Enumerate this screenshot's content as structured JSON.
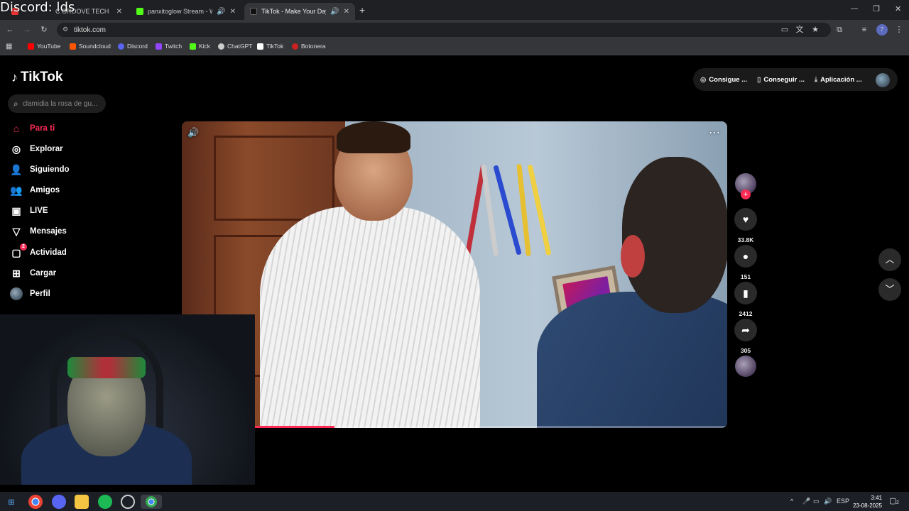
{
  "overlay": {
    "discord_text": "Discord: lds"
  },
  "tabs": [
    {
      "label": "C GROOVE TECH",
      "active": false
    },
    {
      "label": "panxitoglow Stream - Wat",
      "active": false
    },
    {
      "label": "TikTok - Make Your Day",
      "active": true
    }
  ],
  "new_tab": "+",
  "window": {
    "minimize": "—",
    "restore": "❐",
    "close": "✕"
  },
  "address": {
    "url": "tiktok.com"
  },
  "bookmarks": [
    {
      "label": "YouTube",
      "color": "#ff0000"
    },
    {
      "label": "Soundcloud",
      "color": "#ff5500"
    },
    {
      "label": "Discord",
      "color": "#5865f2"
    },
    {
      "label": "Twitch",
      "color": "#9146ff"
    },
    {
      "label": "Kick",
      "color": "#53fc18"
    },
    {
      "label": "ChatGPT",
      "color": "#cccccc"
    },
    {
      "label": "TikTok",
      "color": "#ffffff"
    },
    {
      "label": "Botonera",
      "color": "#cc2222"
    }
  ],
  "tiktok": {
    "logo": "TikTok",
    "search_placeholder": "clamidia la rosa de gu...",
    "nav": [
      {
        "label": "Para ti",
        "icon": "home-icon",
        "active": true
      },
      {
        "label": "Explorar",
        "icon": "compass-icon"
      },
      {
        "label": "Siguiendo",
        "icon": "following-icon"
      },
      {
        "label": "Amigos",
        "icon": "friends-icon"
      },
      {
        "label": "LIVE",
        "icon": "live-icon"
      },
      {
        "label": "Mensajes",
        "icon": "messages-icon"
      },
      {
        "label": "Actividad",
        "icon": "activity-icon",
        "badge": "2"
      },
      {
        "label": "Cargar",
        "icon": "upload-icon"
      },
      {
        "label": "Perfil",
        "icon": "profile-icon"
      }
    ],
    "topright": {
      "coins": "Consigue ...",
      "get_app": "Conseguir ...",
      "app": "Aplicación ..."
    },
    "video": {
      "progress_fraction": 0.28
    },
    "actions": {
      "likes": "33.8K",
      "comments": "151",
      "saves": "2412",
      "shares": "305"
    }
  },
  "taskbar": {
    "language": "ESP",
    "time": "3:41",
    "date": "23-08-2025",
    "notification_count": "2"
  }
}
